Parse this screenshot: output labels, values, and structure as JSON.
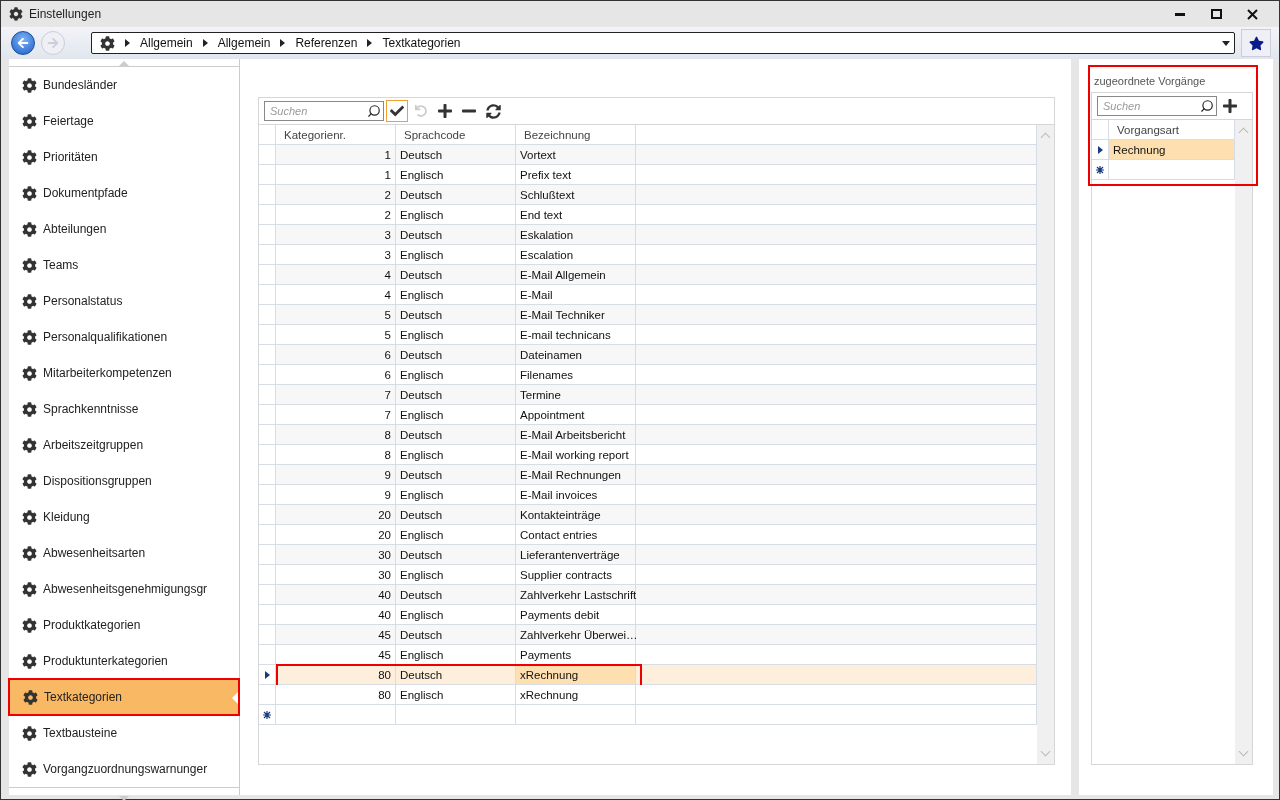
{
  "window": {
    "title": "Einstellungen"
  },
  "breadcrumb": [
    "Allgemein",
    "Allgemein",
    "Referenzen",
    "Textkategorien"
  ],
  "sidebar": {
    "items": [
      {
        "label": "Bundesländer",
        "selected": false,
        "highlighted": false
      },
      {
        "label": "Feiertage",
        "selected": false,
        "highlighted": false
      },
      {
        "label": "Prioritäten",
        "selected": false,
        "highlighted": false
      },
      {
        "label": "Dokumentpfade",
        "selected": false,
        "highlighted": false
      },
      {
        "label": "Abteilungen",
        "selected": false,
        "highlighted": false
      },
      {
        "label": "Teams",
        "selected": false,
        "highlighted": false
      },
      {
        "label": "Personalstatus",
        "selected": false,
        "highlighted": false
      },
      {
        "label": "Personalqualifikationen",
        "selected": false,
        "highlighted": false
      },
      {
        "label": "Mitarbeiterkompetenzen",
        "selected": false,
        "highlighted": false
      },
      {
        "label": "Sprachkenntnisse",
        "selected": false,
        "highlighted": false
      },
      {
        "label": "Arbeitszeitgruppen",
        "selected": false,
        "highlighted": false
      },
      {
        "label": "Dispositionsgruppen",
        "selected": false,
        "highlighted": false
      },
      {
        "label": "Kleidung",
        "selected": false,
        "highlighted": false
      },
      {
        "label": "Abwesenheitsarten",
        "selected": false,
        "highlighted": false
      },
      {
        "label": "Abwesenheitsgenehmigungsgr",
        "selected": false,
        "highlighted": false
      },
      {
        "label": "Produktkategorien",
        "selected": false,
        "highlighted": false
      },
      {
        "label": "Produktunterkategorien",
        "selected": false,
        "highlighted": false
      },
      {
        "label": "Textkategorien",
        "selected": true,
        "highlighted": true
      },
      {
        "label": "Textbausteine",
        "selected": false,
        "highlighted": false
      },
      {
        "label": "Vorgangzuordnungswarnunger",
        "selected": false,
        "highlighted": false
      }
    ]
  },
  "table": {
    "search": {
      "placeholder": "Suchen"
    },
    "columns": [
      "Kategorienr.",
      "Sprachcode",
      "Bezeichnung"
    ],
    "rows": [
      {
        "cells": [
          "1",
          "Deutsch",
          "Vortext"
        ],
        "selected": false,
        "highlighted": false
      },
      {
        "cells": [
          "1",
          "Englisch",
          "Prefix text"
        ],
        "selected": false,
        "highlighted": false
      },
      {
        "cells": [
          "2",
          "Deutsch",
          "Schlußtext"
        ],
        "selected": false,
        "highlighted": false
      },
      {
        "cells": [
          "2",
          "Englisch",
          "End text"
        ],
        "selected": false,
        "highlighted": false
      },
      {
        "cells": [
          "3",
          "Deutsch",
          "Eskalation"
        ],
        "selected": false,
        "highlighted": false
      },
      {
        "cells": [
          "3",
          "Englisch",
          "Escalation"
        ],
        "selected": false,
        "highlighted": false
      },
      {
        "cells": [
          "4",
          "Deutsch",
          "E-Mail Allgemein"
        ],
        "selected": false,
        "highlighted": false
      },
      {
        "cells": [
          "4",
          "Englisch",
          "E-Mail"
        ],
        "selected": false,
        "highlighted": false
      },
      {
        "cells": [
          "5",
          "Deutsch",
          "E-Mail Techniker"
        ],
        "selected": false,
        "highlighted": false
      },
      {
        "cells": [
          "5",
          "Englisch",
          "E-mail technicans"
        ],
        "selected": false,
        "highlighted": false
      },
      {
        "cells": [
          "6",
          "Deutsch",
          "Dateinamen"
        ],
        "selected": false,
        "highlighted": false
      },
      {
        "cells": [
          "6",
          "Englisch",
          "Filenames"
        ],
        "selected": false,
        "highlighted": false
      },
      {
        "cells": [
          "7",
          "Deutsch",
          "Termine"
        ],
        "selected": false,
        "highlighted": false
      },
      {
        "cells": [
          "7",
          "Englisch",
          "Appointment"
        ],
        "selected": false,
        "highlighted": false
      },
      {
        "cells": [
          "8",
          "Deutsch",
          "E-Mail Arbeitsbericht"
        ],
        "selected": false,
        "highlighted": false
      },
      {
        "cells": [
          "8",
          "Englisch",
          "E-Mail working report"
        ],
        "selected": false,
        "highlighted": false
      },
      {
        "cells": [
          "9",
          "Deutsch",
          "E-Mail Rechnungen"
        ],
        "selected": false,
        "highlighted": false
      },
      {
        "cells": [
          "9",
          "Englisch",
          "E-Mail invoices"
        ],
        "selected": false,
        "highlighted": false
      },
      {
        "cells": [
          "20",
          "Deutsch",
          "Kontakteinträge"
        ],
        "selected": false,
        "highlighted": false
      },
      {
        "cells": [
          "20",
          "Englisch",
          "Contact entries"
        ],
        "selected": false,
        "highlighted": false
      },
      {
        "cells": [
          "30",
          "Deutsch",
          "Lieferantenverträge"
        ],
        "selected": false,
        "highlighted": false
      },
      {
        "cells": [
          "30",
          "Englisch",
          "Supplier contracts"
        ],
        "selected": false,
        "highlighted": false
      },
      {
        "cells": [
          "40",
          "Deutsch",
          "Zahlverkehr Lastschrift"
        ],
        "selected": false,
        "highlighted": false
      },
      {
        "cells": [
          "40",
          "Englisch",
          "Payments debit"
        ],
        "selected": false,
        "highlighted": false
      },
      {
        "cells": [
          "45",
          "Deutsch",
          "Zahlverkehr Überwei…"
        ],
        "selected": false,
        "highlighted": false
      },
      {
        "cells": [
          "45",
          "Englisch",
          "Payments"
        ],
        "selected": false,
        "highlighted": false
      },
      {
        "cells": [
          "80",
          "Deutsch",
          "xRechnung"
        ],
        "selected": true,
        "highlighted": true
      },
      {
        "cells": [
          "80",
          "Englisch",
          "xRechnung"
        ],
        "selected": false,
        "highlighted": false
      }
    ]
  },
  "assigned": {
    "title": "zugeordnete Vorgänge",
    "highlighted": true,
    "search": {
      "placeholder": "Suchen"
    },
    "columns": [
      "Vorgangsart"
    ],
    "rows": [
      {
        "cells": [
          "Rechnung"
        ],
        "selected": true
      }
    ]
  }
}
